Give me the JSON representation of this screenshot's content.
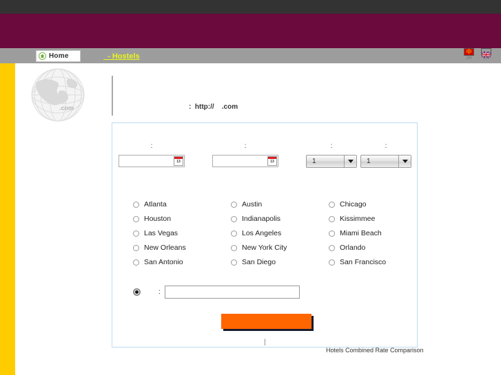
{
  "chrome": {
    "top_band_color": "#333333",
    "brand_band_color": "#6b0a3c",
    "nav_band_color": "#9d9d9d",
    "rail_color": "#ffcc00",
    "accent_color": "#ff6600",
    "link_color": "#e9f71a",
    "panel_border_color": "#bcdcf0"
  },
  "nav": {
    "home_label": "Home",
    "home_icon": "home-icon",
    "hostels_link": "  - Hostels",
    "languages": [
      {
        "code": "ZH",
        "icon": "flag-china-icon",
        "glyph": "中"
      },
      {
        "code": "EN",
        "icon": "flag-uk-icon"
      }
    ]
  },
  "logo": {
    "icon": "globe-icon",
    "suffix": ".com"
  },
  "header": {
    "title": "",
    "url_line": ":  http://    .com"
  },
  "search_form": {
    "fields": [
      {
        "name": "checkin",
        "label": ":",
        "type": "date",
        "value": "",
        "icon": "calendar-icon",
        "icon_day": "13"
      },
      {
        "name": "checkout",
        "label": ":",
        "type": "date",
        "value": "",
        "icon": "calendar-icon",
        "icon_day": "13"
      },
      {
        "name": "rooms",
        "label": ":",
        "type": "select",
        "value": "1",
        "icon": "chevron-down-icon"
      },
      {
        "name": "guests",
        "label": ":",
        "type": "select",
        "value": "1",
        "icon": "chevron-down-icon"
      }
    ],
    "cities": [
      "Atlanta",
      "Austin",
      "Chicago",
      "Houston",
      "Indianapolis",
      "Kissimmee",
      "Las Vegas",
      "Los Angeles",
      "Miami Beach",
      "New Orleans",
      "New York City",
      "Orlando",
      "San Antonio",
      "San Diego",
      "San Francisco"
    ],
    "other": {
      "selected": true,
      "label": ":",
      "value": "",
      "placeholder": ""
    },
    "submit_label": ""
  },
  "footer": {
    "separator": "|",
    "note": "Hotels Combined Rate Comparison"
  }
}
